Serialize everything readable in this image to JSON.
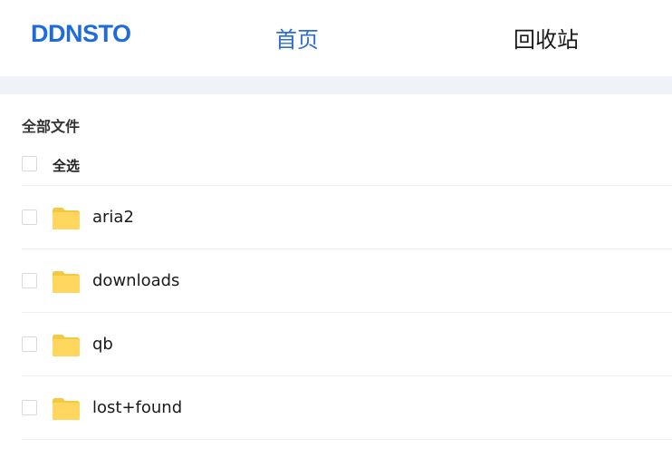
{
  "header": {
    "logo": "DDNSTO",
    "nav": [
      {
        "label": "首页",
        "active": true
      },
      {
        "label": "回收站",
        "active": false
      }
    ],
    "active_color": "#2b6fd6",
    "logo_color": "#1f6bdc"
  },
  "main": {
    "section_title": "全部文件",
    "select_all_label": "全选",
    "folder_icon": "folder-icon",
    "folder_color": "#ffd75e",
    "files": [
      {
        "name": "aria2"
      },
      {
        "name": "downloads"
      },
      {
        "name": "qb"
      },
      {
        "name": "lost+found"
      }
    ]
  }
}
